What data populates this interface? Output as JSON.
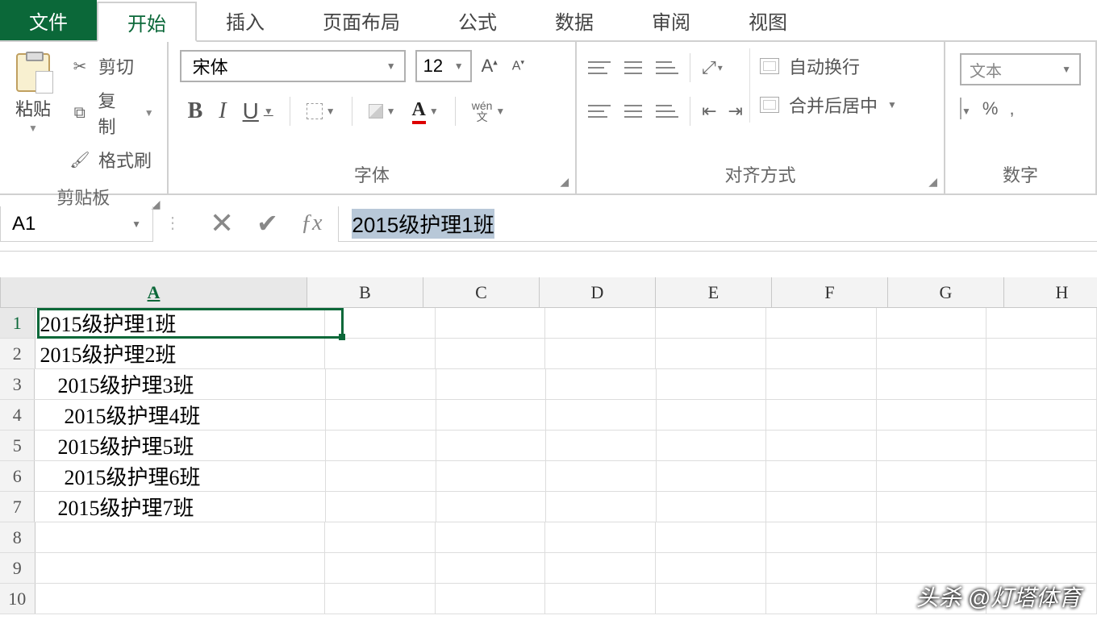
{
  "tabs": {
    "file": "文件",
    "home": "开始",
    "insert": "插入",
    "layout": "页面布局",
    "formulas": "公式",
    "data": "数据",
    "review": "审阅",
    "view": "视图"
  },
  "clipboard": {
    "paste": "粘贴",
    "cut": "剪切",
    "copy": "复制",
    "format_painter": "格式刷",
    "group_label": "剪贴板"
  },
  "font": {
    "name": "宋体",
    "size": "12",
    "group_label": "字体",
    "bold": "B",
    "italic": "I",
    "underline": "U",
    "fontcolor_letter": "A",
    "wen_top": "wén",
    "wen_bot": "文"
  },
  "alignment": {
    "wrap": "自动换行",
    "merge": "合并后居中",
    "group_label": "对齐方式"
  },
  "number": {
    "format": "文本",
    "group_label": "数字",
    "percent": "%"
  },
  "namebox": "A1",
  "formula_value": "2015级护理1班",
  "columns": [
    "A",
    "B",
    "C",
    "D",
    "E",
    "F",
    "G",
    "H"
  ],
  "rows": [
    {
      "n": "1",
      "a": "2015级护理1班",
      "pad": ""
    },
    {
      "n": "2",
      "a": "2015级护理2班",
      "pad": ""
    },
    {
      "n": "3",
      "a": "2015级护理3班",
      "pad": "pad1"
    },
    {
      "n": "4",
      "a": "2015级护理4班",
      "pad": "pad2"
    },
    {
      "n": "5",
      "a": "2015级护理5班",
      "pad": "pad1"
    },
    {
      "n": "6",
      "a": "2015级护理6班",
      "pad": "pad2"
    },
    {
      "n": "7",
      "a": "2015级护理7班",
      "pad": "pad1"
    },
    {
      "n": "8",
      "a": "",
      "pad": ""
    },
    {
      "n": "9",
      "a": "",
      "pad": ""
    },
    {
      "n": "10",
      "a": "",
      "pad": ""
    }
  ],
  "watermark": "头杀 @灯塔体育"
}
